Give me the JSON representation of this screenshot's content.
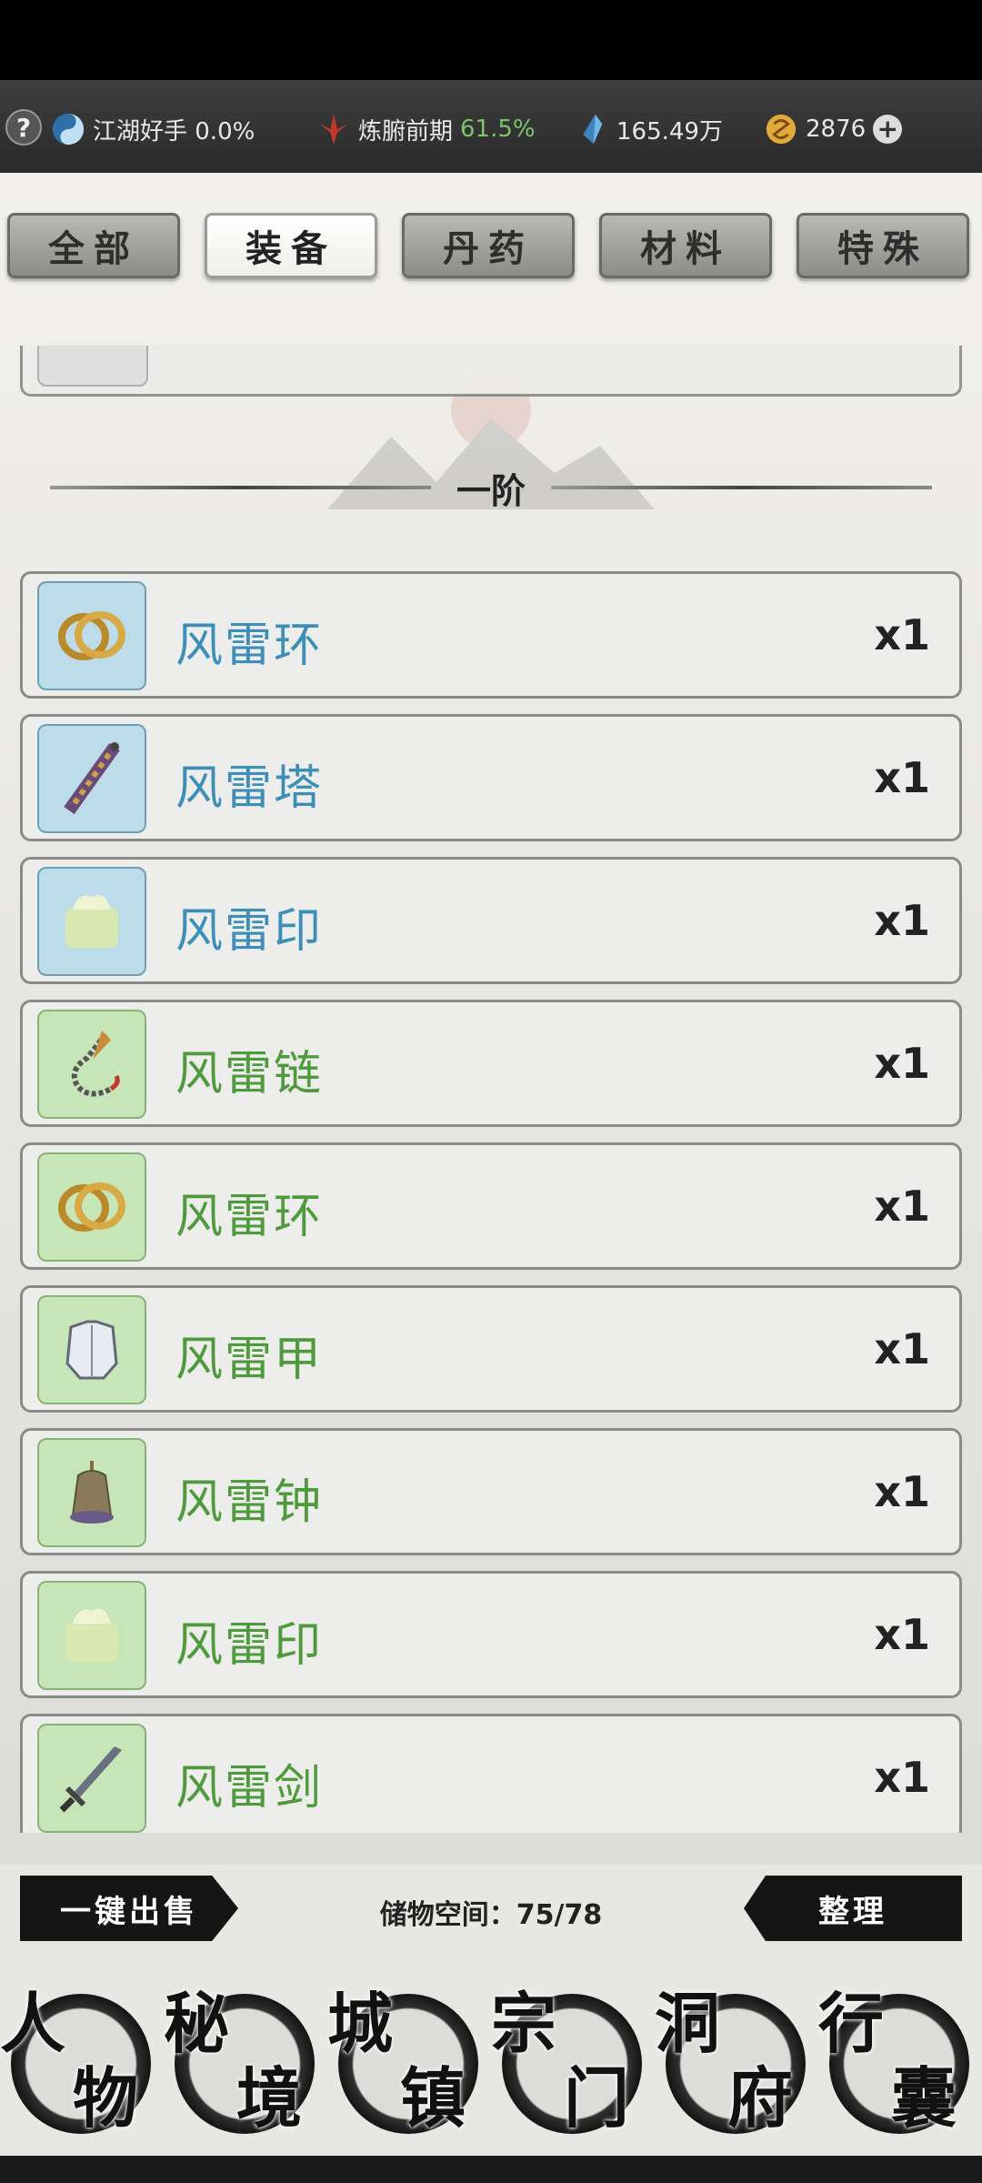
{
  "topbar": {
    "help_label": "?",
    "rank": "江湖好手 0.0%",
    "realm_name": "炼腑前期",
    "realm_percent": "61.5%",
    "spirit_stones": "165.49万",
    "coins": "2876",
    "plus_label": "+"
  },
  "tabs": [
    {
      "label": "全部",
      "active": false
    },
    {
      "label": "装备",
      "active": true
    },
    {
      "label": "丹药",
      "active": false
    },
    {
      "label": "材料",
      "active": false
    },
    {
      "label": "特殊",
      "active": false
    }
  ],
  "section": {
    "title": "一阶"
  },
  "items": [
    {
      "name": "风雷环",
      "qty": "x1",
      "rarity": "blue",
      "icon": "ring-icon"
    },
    {
      "name": "风雷塔",
      "qty": "x1",
      "rarity": "blue",
      "icon": "tower-icon"
    },
    {
      "name": "风雷印",
      "qty": "x1",
      "rarity": "blue",
      "icon": "seal-icon"
    },
    {
      "name": "风雷链",
      "qty": "x1",
      "rarity": "green",
      "icon": "chain-icon"
    },
    {
      "name": "风雷环",
      "qty": "x1",
      "rarity": "green",
      "icon": "ring-icon"
    },
    {
      "name": "风雷甲",
      "qty": "x1",
      "rarity": "green",
      "icon": "armor-icon"
    },
    {
      "name": "风雷钟",
      "qty": "x1",
      "rarity": "green",
      "icon": "bell-icon"
    },
    {
      "name": "风雷印",
      "qty": "x1",
      "rarity": "green",
      "icon": "seal-icon"
    },
    {
      "name": "风雷剑",
      "qty": "x1",
      "rarity": "green",
      "icon": "sword-icon"
    }
  ],
  "footer": {
    "sell_all_label": "一键出售",
    "storage_text": "储物空间：75/78",
    "sort_label": "整理"
  },
  "nav": [
    {
      "c1": "人",
      "c2": "物"
    },
    {
      "c1": "秘",
      "c2": "境"
    },
    {
      "c1": "城",
      "c2": "镇"
    },
    {
      "c1": "宗",
      "c2": "门"
    },
    {
      "c1": "洞",
      "c2": "府"
    },
    {
      "c1": "行",
      "c2": "囊"
    }
  ],
  "colors": {
    "blue_rarity": "#3d8fb7",
    "green_rarity": "#4f9a3c",
    "realm_percent": "#7ac46a"
  }
}
